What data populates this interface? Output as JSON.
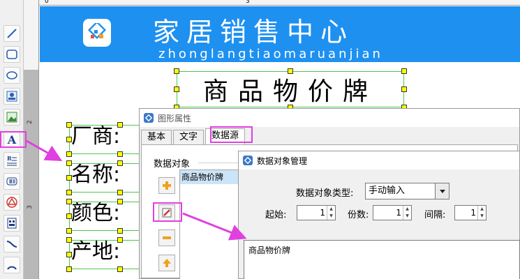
{
  "canvas": {
    "banner_title": "家居销售中心",
    "banner_subtitle": "zhonglangtiaomaruanjian",
    "label_title": "商品物价牌",
    "fields": [
      "厂商:",
      "名称:",
      "颜色:",
      "产地:"
    ]
  },
  "ruler": {
    "top_numbers": [
      "0",
      "3"
    ],
    "left_numbers": [
      "2",
      "3"
    ]
  },
  "toolbar": {
    "items": [
      "line",
      "rounded-rect",
      "ellipse",
      "image",
      "picture",
      "text",
      "rich-text",
      "barcode",
      "qrcode",
      "data-matrix",
      "curve",
      "arc"
    ],
    "text_tool_glyph": "A"
  },
  "shape_dialog": {
    "title": "图形属性",
    "tabs": [
      "基本",
      "文字",
      "数据源"
    ],
    "active_tab": "数据源",
    "group_label": "数据对象",
    "list_items": [
      "商品物价牌"
    ]
  },
  "data_dialog": {
    "title": "数据对象管理",
    "type_label": "数据对象类型:",
    "type_value": "手动输入",
    "start_label": "起始:",
    "start_value": "1",
    "copies_label": "份数:",
    "copies_value": "1",
    "interval_label": "间隔:",
    "interval_value": "1",
    "content": "商品物价牌"
  },
  "colors": {
    "banner": "#1e90f0",
    "highlight": "#e040e0",
    "handle": "#ffff00",
    "selection": "#4cc84c"
  }
}
